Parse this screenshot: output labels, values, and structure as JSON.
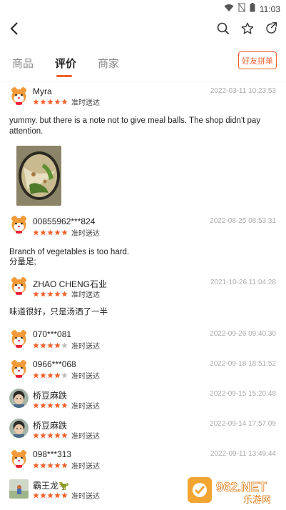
{
  "status_bar": {
    "time": "11:03"
  },
  "tabs": [
    {
      "label": "商品",
      "active": false
    },
    {
      "label": "评价",
      "active": true
    },
    {
      "label": "商家",
      "active": false
    }
  ],
  "group_button": "好友拼单",
  "colors": {
    "accent": "#f0602a",
    "star": "#f0602a",
    "star_empty": "#bdbdbd"
  },
  "reviews": [
    {
      "name": "Myra",
      "date": "2022-03-11 10:23:53",
      "rating": 5,
      "delivery": "准时送达",
      "avatar": "hamster-avatar",
      "comment": "yummy.  but there is a note not to give meal balls.  The shop didn't pay attention.",
      "has_photo": true
    },
    {
      "name": "00855962***824",
      "date": "2022-08-25 08:53:31",
      "rating": 5,
      "delivery": "准时送达",
      "avatar": "hamster-avatar",
      "comment_lines": [
        "Branch of vegetables is too hard.",
        "分量足;"
      ]
    },
    {
      "name": "ZHAO CHENG石业",
      "date": "2021-10-26 11:04:28",
      "rating": 5,
      "delivery": "准时送达",
      "avatar": "hamster-avatar",
      "comment": "味道很好，只是汤洒了一半"
    },
    {
      "name": "070***081",
      "date": "2022-09-26 09:40:30",
      "rating": 4,
      "delivery": "准时送达",
      "avatar": "hamster-avatar"
    },
    {
      "name": "0966***068",
      "date": "2022-09-18 18:51:52",
      "rating": 4,
      "delivery": "准时送达",
      "avatar": "hamster-avatar"
    },
    {
      "name": "桥豆麻跌",
      "date": "2022-09-15 15:20:48",
      "rating": 5,
      "delivery": "准时送达",
      "avatar": "child-photo-avatar"
    },
    {
      "name": "桥豆麻跌",
      "date": "2022-09-14 17:57:09",
      "rating": 5,
      "delivery": "准时送达",
      "avatar": "child-photo-avatar"
    },
    {
      "name": "098***313",
      "date": "2022-09-11 13:49:44",
      "rating": 5,
      "delivery": "准时送达",
      "avatar": "hamster-avatar"
    },
    {
      "name": "霸王龙🦖",
      "date": "",
      "rating": 5,
      "delivery": "准时送达",
      "avatar": "photo-avatar"
    }
  ],
  "watermark": {
    "brand": "962.NET",
    "sub": "乐游网"
  }
}
